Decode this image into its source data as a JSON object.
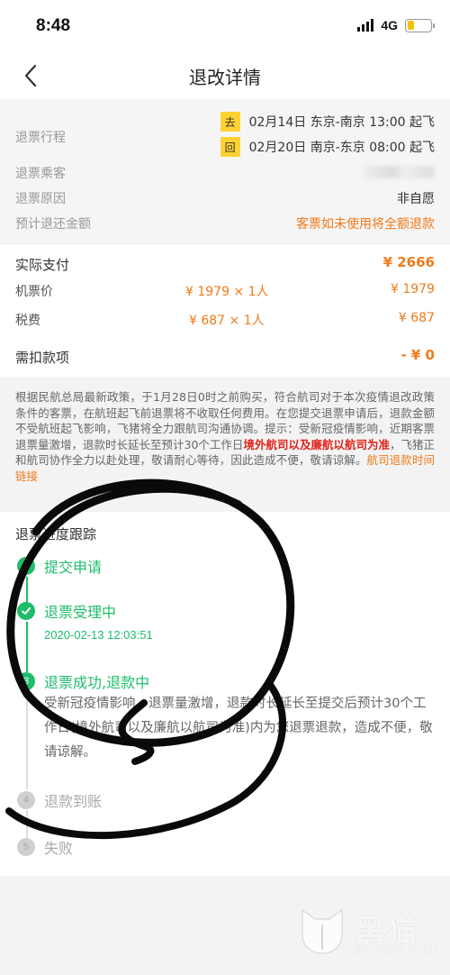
{
  "status_bar": {
    "time": "8:48",
    "network": "4G"
  },
  "nav": {
    "title": "退改详情"
  },
  "info": {
    "trip_label": "退票行程",
    "trips": [
      {
        "tag": "去",
        "text": "02月14日 东京-南京 13:00 起飞"
      },
      {
        "tag": "回",
        "text": "02月20日 南京-东京 08:00 起飞"
      }
    ],
    "passenger_label": "退票乘客",
    "reason_label": "退票原因",
    "reason_value": "非自愿",
    "refund_label": "预计退还金额",
    "refund_value": "客票如未使用将全额退款"
  },
  "payment": {
    "actual_label": "实际支付",
    "actual_value": "¥ 2666",
    "ticket_label": "机票价",
    "ticket_calc": "¥ 1979 × 1人",
    "ticket_value": "¥ 1979",
    "tax_label": "税费",
    "tax_calc": "¥ 687 × 1人",
    "tax_value": "¥ 687",
    "deduct_label": "需扣款项",
    "deduct_value": "- ¥ 0"
  },
  "notice": {
    "text_1": "根据民航总局最新政策，于1月28日0时之前购买，符合航司对于本次疫情退改政策条件的客票，在航班起飞前退票将不收取任何费用。在您提交退票申请后，退款金额不受航班起飞影响，飞猪将全力跟航司沟通协调。提示：受新冠疫情影响，近期客票退票量激增，退款时长延长至预计30个工作日",
    "highlight": "境外航司以及廉航以航司为准",
    "text_2": "，飞猪正和航司协作全力以赴处理，敬请耐心等待，因此造成不便，敬请谅解。",
    "link": "航司退款时间链接"
  },
  "progress": {
    "title": "退票进度跟踪",
    "steps": [
      {
        "num": "1",
        "label": "提交申请"
      },
      {
        "num": "2",
        "label": "退票受理中",
        "time": "2020-02-13 12:03:51"
      },
      {
        "num": "3",
        "label": "退票成功,退款中",
        "desc": "受新冠疫情影响，退票量激增，退款时长延长至提交后预计30个工作日(境外航司以及廉航以航司为准)内为您退票退款，造成不便，敬请谅解。"
      },
      {
        "num": "4",
        "label": "退款到账"
      },
      {
        "num": "5",
        "label": "失败"
      }
    ]
  },
  "watermark": {
    "big": "黑猫",
    "small": "BLACK CAT"
  },
  "colors": {
    "accent": "#f07a1a",
    "success": "#1fbd6a",
    "highlight_red": "#e0241b",
    "tag_yellow": "#ffd233"
  }
}
